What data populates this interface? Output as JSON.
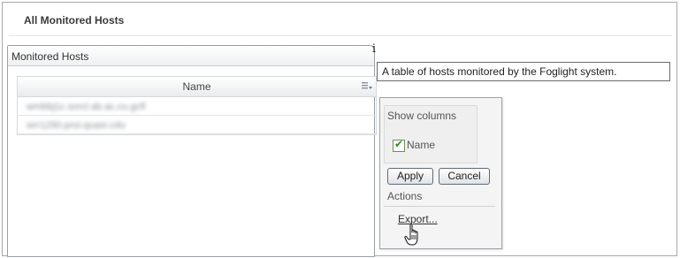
{
  "page": {
    "title": "All Monitored Hosts"
  },
  "panel": {
    "title": "Monitored Hosts",
    "info_icon_glyph": "i"
  },
  "table": {
    "column_header": "Name",
    "rows": [
      {
        "name": "wmbbj1c.sorcl.ab.ac.cu.gcfl"
      },
      {
        "name": "wrr1290.proi.quasr.cdu"
      }
    ]
  },
  "tooltip": {
    "text": "A table of hosts monitored by the Foglight system."
  },
  "column_popup": {
    "show_columns_label": "Show columns",
    "columns": [
      {
        "label": "Name",
        "checked": true
      }
    ],
    "apply_label": "Apply",
    "cancel_label": "Cancel",
    "actions_label": "Actions",
    "export_label": "Export..."
  },
  "icons": {
    "info": "info-icon",
    "column_menu": "column-menu-icon",
    "checkbox_check": "check-icon",
    "cursor": "hand-pointer-icon"
  },
  "colors": {
    "check_green": "#2f8a1e"
  }
}
